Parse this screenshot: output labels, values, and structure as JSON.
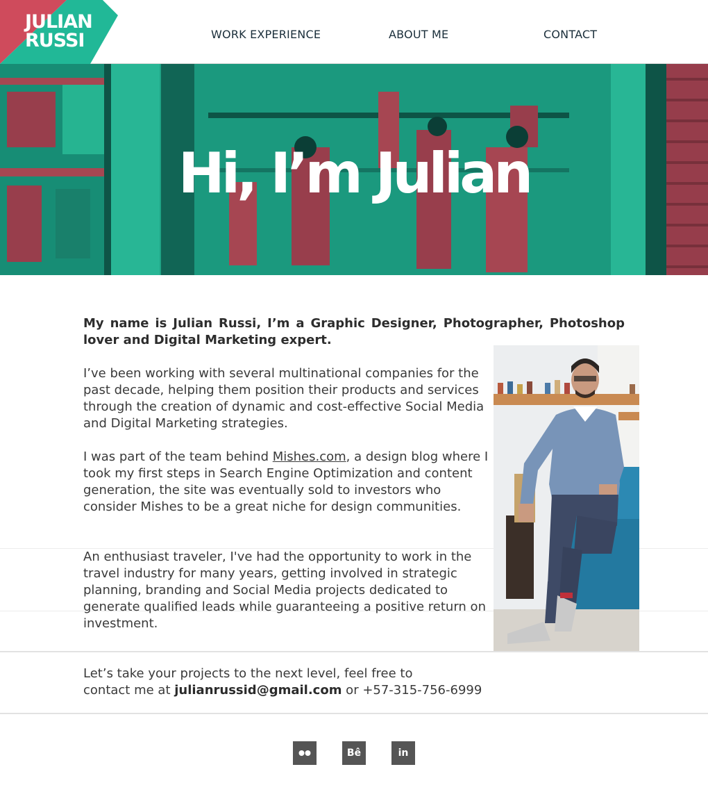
{
  "brand": {
    "logo_line1": "JULIAN",
    "logo_line2": "RUSSI",
    "colors": {
      "teal": "#21b897",
      "red": "#cf4b5c",
      "dark": "#1a2e3a"
    }
  },
  "nav": {
    "items": [
      {
        "label": "WORK EXPERIENCE"
      },
      {
        "label": "ABOUT ME"
      },
      {
        "label": "CONTACT"
      }
    ]
  },
  "hero": {
    "title": "Hi, I’m Julian"
  },
  "content": {
    "intro": "My name is Julian Russi, I’m a Graphic Designer, Photographer, Photoshop lover and Digital Marketing expert.",
    "p1": "I’ve been working with several multinational companies for the past decade, helping them position their products and services through the creation of dynamic and cost-effective Social Media and Digital Marketing strategies.",
    "p2_before": "I was part of the team behind ",
    "p2_link": "Mishes.com",
    "p2_after": ", a design blog where I took my first steps in Search Engine Optimization and content generation, the site was eventually sold to investors who consider Mishes to be a great niche for design communities.",
    "p3": "An enthusiast traveler, I've had the opportunity to work in the travel industry for many years, getting involved in strategic planning, branding and Social Media projects dedicated to generate qualified leads while guaranteeing a positive return on investment."
  },
  "contact": {
    "line1": "Let’s take your projects to the next level, feel free to",
    "line2_before": "contact me at ",
    "email": "julianrussid@gmail.com",
    "line2_mid": " or ",
    "phone": "+57-315-756-6999"
  },
  "social": {
    "items": [
      {
        "icon": "flickr-icon",
        "glyph": "●●"
      },
      {
        "icon": "behance-icon",
        "glyph": "Bê"
      },
      {
        "icon": "linkedin-icon",
        "glyph": "in"
      }
    ]
  }
}
